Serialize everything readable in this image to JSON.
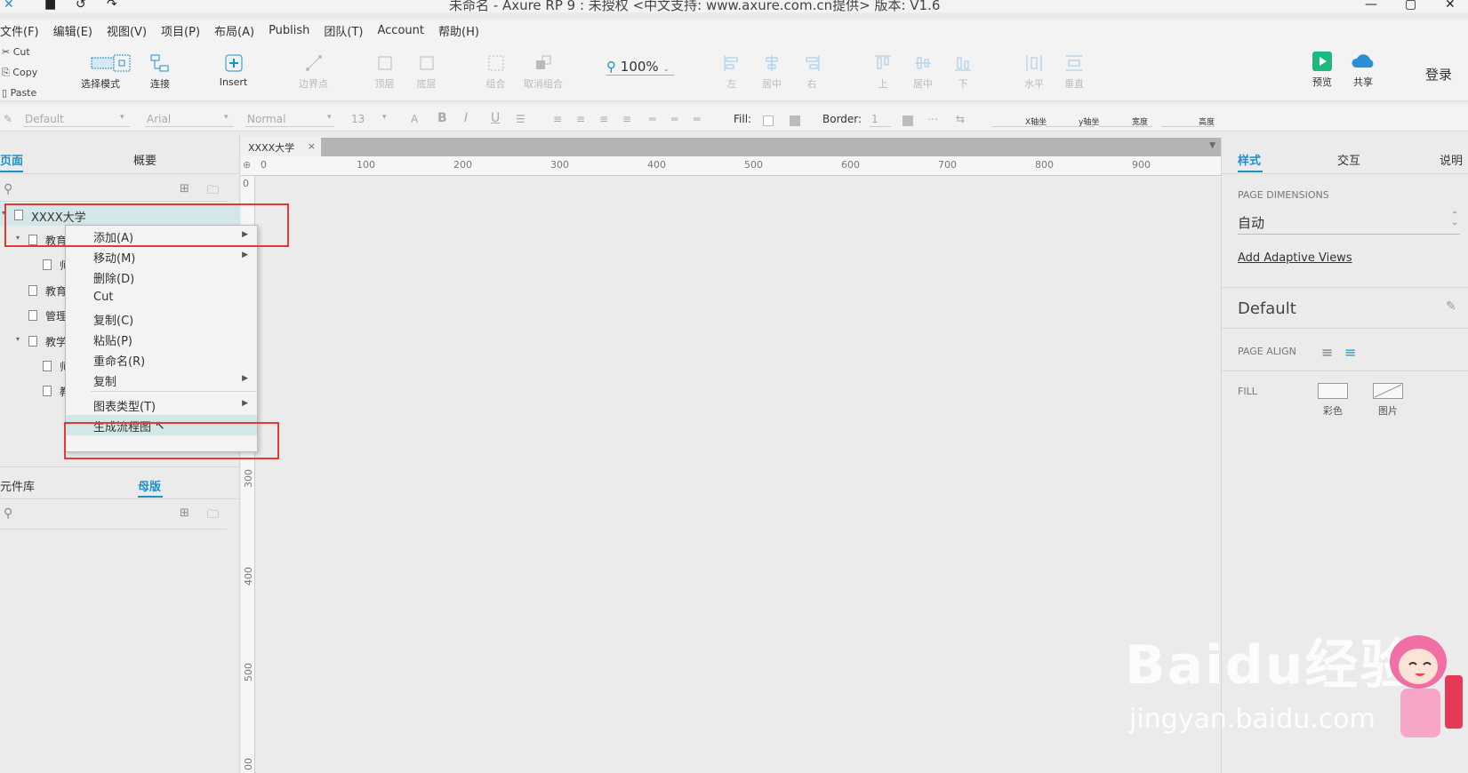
{
  "window": {
    "title": "未命名 - Axure RP 9 : 未授权    <中文支持: www.axure.com.cn提供> 版本: V1.6"
  },
  "menubar": [
    "文件(F)",
    "编辑(E)",
    "视图(V)",
    "项目(P)",
    "布局(A)",
    "Publish",
    "团队(T)",
    "Account",
    "帮助(H)"
  ],
  "clipboard": {
    "cut": "Cut",
    "copy": "Copy",
    "paste": "Paste"
  },
  "toolbar": {
    "select_mode": "选择模式",
    "connect": "连接",
    "insert": "Insert",
    "points": "边界点",
    "top": "顶层",
    "bottom": "底层",
    "group": "组合",
    "ungroup": "取消组合",
    "zoom": "100%",
    "left": "左",
    "center": "居中",
    "right": "右",
    "up": "上",
    "middle": "居中",
    "down": "下",
    "horizontal": "水平",
    "vertical": "垂直",
    "preview": "预览",
    "share": "共享",
    "login": "登录"
  },
  "formatbar": {
    "style": "Default",
    "font": "Arial",
    "weight": "Normal",
    "size": "13",
    "fill_label": "Fill:",
    "border_label": "Border:",
    "border_value": "1",
    "x_label": "X轴坐",
    "y_label": "y轴坐",
    "w_label": "宽度",
    "h_label": "高度"
  },
  "left_panel": {
    "tabs": {
      "pages": "页面",
      "outline": "概要"
    },
    "tree": [
      {
        "label": "XXXX大学",
        "level": 0
      },
      {
        "label": "教育",
        "level": 1
      },
      {
        "label": "师",
        "level": 2
      },
      {
        "label": "教育",
        "level": 1
      },
      {
        "label": "管理",
        "level": 1
      },
      {
        "label": "教学",
        "level": 1
      },
      {
        "label": "师",
        "level": 2
      },
      {
        "label": "教",
        "level": 2
      }
    ],
    "lib_tabs": {
      "library": "元件库",
      "masters": "母版"
    }
  },
  "context_menu": {
    "items": [
      "添加(A)",
      "移动(M)",
      "删除(D)",
      "Cut",
      "复制(C)",
      "粘贴(P)",
      "重命名(R)",
      "复制",
      "图表类型(T)",
      "生成流程图"
    ]
  },
  "canvas": {
    "tab": "XXXX大学",
    "ruler_h": [
      "0",
      "100",
      "200",
      "300",
      "400",
      "500",
      "600",
      "700",
      "800",
      "900"
    ],
    "ruler_v": [
      "0",
      "300",
      "400",
      "500",
      "00"
    ]
  },
  "right_panel": {
    "tabs": {
      "style": "样式",
      "interaction": "交互",
      "notes": "说明"
    },
    "page_dimensions_label": "PAGE DIMENSIONS",
    "page_dimensions_value": "自动",
    "adaptive_link": "Add Adaptive Views",
    "style_name": "Default",
    "page_align_label": "PAGE ALIGN",
    "fill_label": "FILL",
    "fill_color": "彩色",
    "fill_image": "图片"
  },
  "watermark": {
    "main": "Baidu经验",
    "sub": "jingyan.baidu.com"
  },
  "colors": {
    "accent": "#1e90c8",
    "highlight": "#e53935"
  }
}
